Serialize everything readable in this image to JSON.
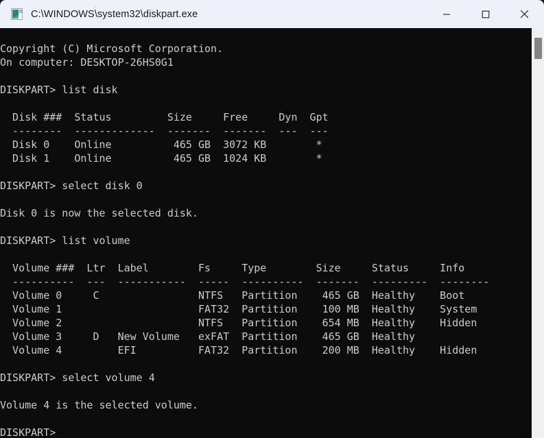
{
  "window": {
    "title": "C:\\WINDOWS\\system32\\diskpart.exe",
    "icon": "console-app-icon",
    "titlebar_bg": "#eef1f8",
    "console_bg": "#0c0c0c",
    "console_fg": "#cccccc"
  },
  "controls": {
    "minimize_label": "Minimize",
    "maximize_label": "Maximize",
    "close_label": "Close"
  },
  "console": {
    "lines": [
      "",
      "Copyright (C) Microsoft Corporation.",
      "On computer: DESKTOP-26HS0G1",
      "",
      "DISKPART> list disk",
      "",
      "  Disk ###  Status         Size     Free     Dyn  Gpt",
      "  --------  -------------  -------  -------  ---  ---",
      "  Disk 0    Online          465 GB  3072 KB        *",
      "  Disk 1    Online          465 GB  1024 KB        *",
      "",
      "DISKPART> select disk 0",
      "",
      "Disk 0 is now the selected disk.",
      "",
      "DISKPART> list volume",
      "",
      "  Volume ###  Ltr  Label        Fs     Type        Size     Status     Info",
      "  ----------  ---  -----------  -----  ----------  -------  ---------  --------",
      "  Volume 0     C                NTFS   Partition    465 GB  Healthy    Boot",
      "  Volume 1                      FAT32  Partition    100 MB  Healthy    System",
      "  Volume 2                      NTFS   Partition    654 MB  Healthy    Hidden",
      "  Volume 3     D   New Volume   exFAT  Partition    465 GB  Healthy",
      "  Volume 4         EFI          FAT32  Partition    200 MB  Healthy    Hidden",
      "",
      "DISKPART> select volume 4",
      "",
      "Volume 4 is the selected volume.",
      "",
      "DISKPART>"
    ],
    "text": "\nCopyright (C) Microsoft Corporation.\nOn computer: DESKTOP-26HS0G1\n\nDISKPART> list disk\n\n  Disk ###  Status         Size     Free     Dyn  Gpt\n  --------  -------------  -------  -------  ---  ---\n  Disk 0    Online          465 GB  3072 KB        *\n  Disk 1    Online          465 GB  1024 KB        *\n\nDISKPART> select disk 0\n\nDisk 0 is now the selected disk.\n\nDISKPART> list volume\n\n  Volume ###  Ltr  Label        Fs     Type        Size     Status     Info\n  ----------  ---  -----------  -----  ----------  -------  ---------  --------\n  Volume 0     C                NTFS   Partition    465 GB  Healthy    Boot\n  Volume 1                      FAT32  Partition    100 MB  Healthy    System\n  Volume 2                      NTFS   Partition    654 MB  Healthy    Hidden\n  Volume 3     D   New Volume   exFAT  Partition    465 GB  Healthy\n  Volume 4         EFI          FAT32  Partition    200 MB  Healthy    Hidden\n\nDISKPART> select volume 4\n\nVolume 4 is the selected volume.\n\nDISKPART>",
    "prompt": "DISKPART>",
    "disk_table": {
      "headers": [
        "Disk ###",
        "Status",
        "Size",
        "Free",
        "Dyn",
        "Gpt"
      ],
      "rows": [
        [
          "Disk 0",
          "Online",
          "465 GB",
          "3072 KB",
          "",
          "*"
        ],
        [
          "Disk 1",
          "Online",
          "465 GB",
          "1024 KB",
          "",
          "*"
        ]
      ]
    },
    "volume_table": {
      "headers": [
        "Volume ###",
        "Ltr",
        "Label",
        "Fs",
        "Type",
        "Size",
        "Status",
        "Info"
      ],
      "rows": [
        [
          "Volume 0",
          "C",
          "",
          "NTFS",
          "Partition",
          "465 GB",
          "Healthy",
          "Boot"
        ],
        [
          "Volume 1",
          "",
          "",
          "FAT32",
          "Partition",
          "100 MB",
          "Healthy",
          "System"
        ],
        [
          "Volume 2",
          "",
          "",
          "NTFS",
          "Partition",
          "654 MB",
          "Healthy",
          "Hidden"
        ],
        [
          "Volume 3",
          "D",
          "New Volume",
          "exFAT",
          "Partition",
          "465 GB",
          "Healthy",
          ""
        ],
        [
          "Volume 4",
          "",
          "EFI",
          "FAT32",
          "Partition",
          "200 MB",
          "Healthy",
          "Hidden"
        ]
      ]
    },
    "commands": [
      "list disk",
      "select disk 0",
      "list volume",
      "select volume 4"
    ],
    "messages": [
      "Copyright (C) Microsoft Corporation.",
      "On computer: DESKTOP-26HS0G1",
      "Disk 0 is now the selected disk.",
      "Volume 4 is the selected volume."
    ],
    "computer_name": "DESKTOP-26HS0G1"
  },
  "scrollbar": {
    "orientation": "vertical",
    "thumb_top_pct": 2,
    "thumb_height_pct": 5
  }
}
